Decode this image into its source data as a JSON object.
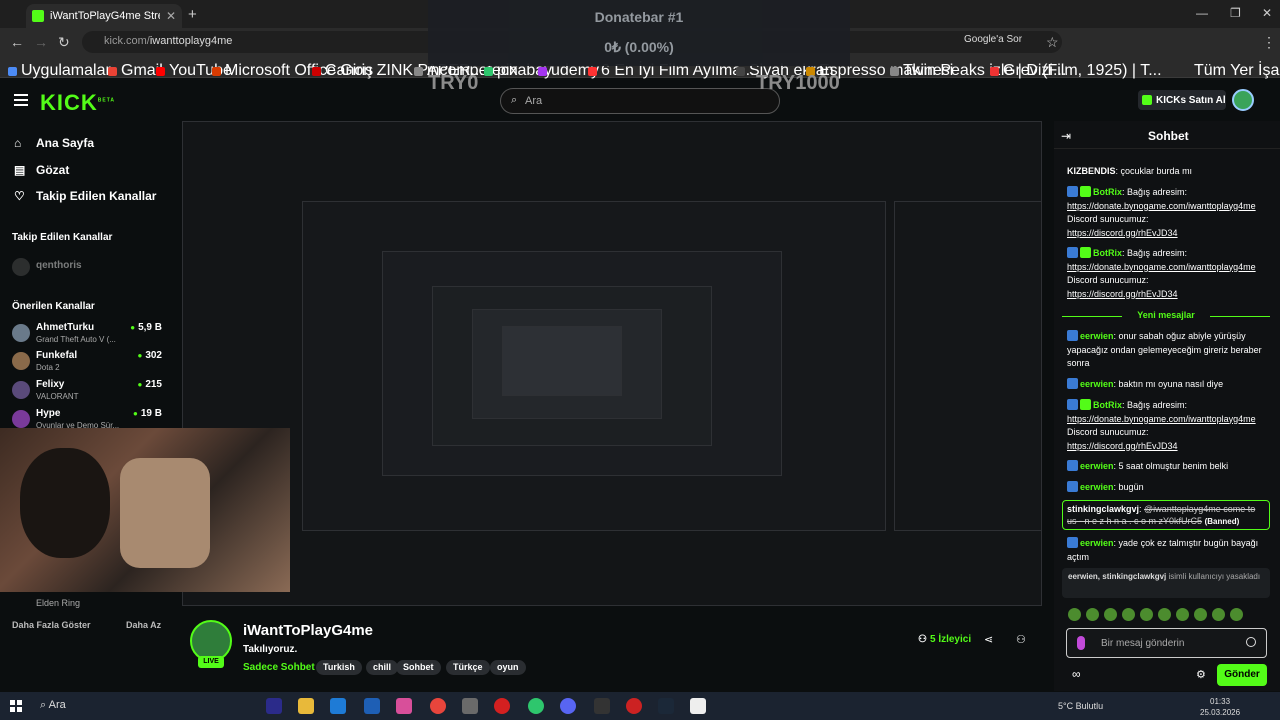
{
  "browser": {
    "tab_title": "iWantToPlayG4me Stream",
    "url_domain": "kick.com/",
    "url_path": "iwanttoplayg4me",
    "google_sor": "Google'a Sor",
    "bookmarks": [
      {
        "label": "Uygulamalar",
        "color": "#4c8bf5"
      },
      {
        "label": "Gmail",
        "color": "#ea4335"
      },
      {
        "label": "YouTube",
        "color": "#ff0000"
      },
      {
        "label": "Microsoft Office Giriş",
        "color": "#d83b01"
      },
      {
        "label": "Canon ZINK PAPER...",
        "color": "#c00"
      },
      {
        "label": "incompetech",
        "color": "#888"
      },
      {
        "label": "pixabay",
        "color": "#2ec66d"
      },
      {
        "label": "udemy",
        "color": "#a435f0"
      },
      {
        "label": "6 En İyi Film Ayılma...",
        "color": "#f33"
      },
      {
        "label": "Siyah ekran",
        "color": "#444"
      },
      {
        "label": "Espresso makinesi",
        "color": "#c80"
      },
      {
        "label": "Twin Peaks izle | Dizi...",
        "color": "#888"
      },
      {
        "label": "Grev (Film, 1925) | T...",
        "color": "#e33"
      }
    ],
    "all_bookmarks": "Tüm Yer İşaretleri"
  },
  "overlay": {
    "donatebar_title": "Donatebar #1",
    "donatebar_amount": "0₺ (0.00%)",
    "try_start": "TRY0",
    "try_end": "TRY1000"
  },
  "header": {
    "logo": "KICK",
    "logo_beta": "BETA",
    "search_placeholder": "Ara",
    "kicks_button": "KICKs Satın Al"
  },
  "sidebar": {
    "nav": [
      {
        "label": "Ana Sayfa",
        "icon": "home-icon"
      },
      {
        "label": "Gözat",
        "icon": "browse-icon"
      },
      {
        "label": "Takip Edilen Kanallar",
        "icon": "heart-icon"
      }
    ],
    "followed_title": "Takip Edilen Kanallar",
    "followed": [
      {
        "name": "qenthoris"
      }
    ],
    "recommended_title": "Önerilen Kanallar",
    "recommended": [
      {
        "name": "AhmetTurku",
        "game": "Grand Theft Auto V (...",
        "viewers": "5,9 B",
        "color": "#6a7a8a"
      },
      {
        "name": "Funkefal",
        "game": "Dota 2",
        "viewers": "302",
        "color": "#8a6a4a"
      },
      {
        "name": "Felixy",
        "game": "VALORANT",
        "viewers": "215",
        "color": "#5a4a7a"
      },
      {
        "name": "Hype",
        "game": "Oyunlar ve Demo Sür...",
        "viewers": "19 B",
        "color": "#7a3a9a"
      }
    ],
    "partial_game": "Elden Ring",
    "show_more": "Daha Fazla Göster",
    "show_less": "Daha Az"
  },
  "channel": {
    "name": "iWantToPlayG4me",
    "title": "Takılıyoruz.",
    "category": "Sadece Sohbet",
    "tags": [
      "Turkish",
      "chill",
      "Sohbet",
      "Türkçe",
      "oyun"
    ],
    "viewers_count": "5",
    "viewers_label": "İzleyici",
    "live": "LIVE"
  },
  "chat": {
    "title": "Sohbet",
    "messages": [
      {
        "user": "KIZBENDIS",
        "text": "çocuklar burda mı",
        "color": "#fff"
      },
      {
        "user": "BotRix",
        "text": "Bağış adresim:",
        "link": "https://donate.bynogame.com/iwanttoplayg4me",
        "extra": "Discord sunucumuz:",
        "link2": "https://discord.gg/rhEvJD34",
        "color": "#53fc18"
      },
      {
        "user": "BotRix",
        "text": "Bağış adresim:",
        "link": "https://donate.bynogame.com/iwanttoplayg4me",
        "extra": "Discord sunucumuz:",
        "link2": "https://discord.gg/rhEvJD34",
        "color": "#53fc18"
      },
      {
        "user": "eerwien",
        "text": "onur sabah oğuz abiyle yürüşüy yapacağız ondan gelemeyeceğim gireriz beraber sonra",
        "color": "#53fc18"
      },
      {
        "user": "eerwien",
        "text": "baktın mı oyuna nasıl diye",
        "color": "#53fc18"
      },
      {
        "user": "BotRix",
        "text": "Bağış adresim:",
        "link": "https://donate.bynogame.com/iwanttoplayg4me",
        "extra": "Discord sunucumuz:",
        "link2": "https://discord.gg/rhEvJD34",
        "color": "#53fc18"
      },
      {
        "user": "eerwien",
        "text": "5 saat olmuştur benim belki",
        "color": "#53fc18"
      },
      {
        "user": "eerwien",
        "text": "bugün",
        "color": "#53fc18"
      },
      {
        "user": "eerwien",
        "text": "yade çok ez talmıştır bugün bayağı açtım",
        "color": "#53fc18"
      }
    ],
    "new_messages": "Yeni mesajlar",
    "banned_user": "stinkingclawkgvj",
    "banned_text": "@iwanttoplayg4me come to us - n e z h n a . c o m zY0kfUrC5",
    "banned_label": "(Banned)",
    "joined_users": "eerwien, stinkingclawkgvj",
    "joined_text": "isimli kullanıcıyı yasakladı",
    "input_placeholder": "Bir mesaj gönderin",
    "send": "Gönder"
  },
  "taskbar": {
    "search": "Ara",
    "weather": "5°C",
    "weather_label": "Bulutlu",
    "time": "01:33",
    "date": "25.03.2026"
  }
}
